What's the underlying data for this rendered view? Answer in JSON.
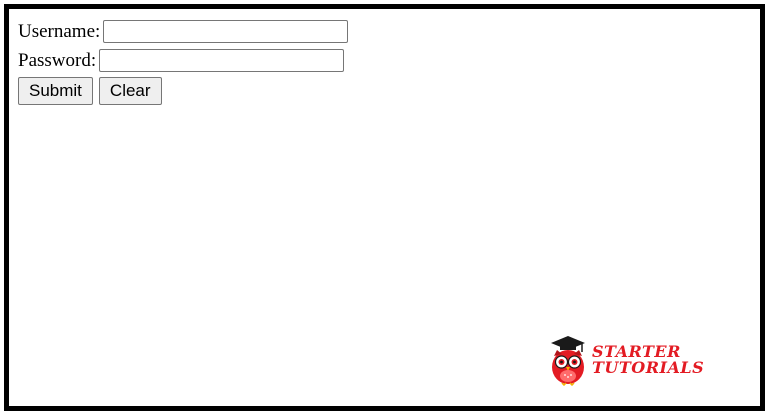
{
  "form": {
    "username_label": "Username:",
    "username_value": "",
    "password_label": "Password:",
    "password_value": "",
    "submit_label": "Submit",
    "clear_label": "Clear"
  },
  "logo": {
    "icon": "owl-graduation-cap-icon",
    "line1": "STARTER",
    "line2": "TUTORIALS",
    "color": "#e31b23"
  }
}
